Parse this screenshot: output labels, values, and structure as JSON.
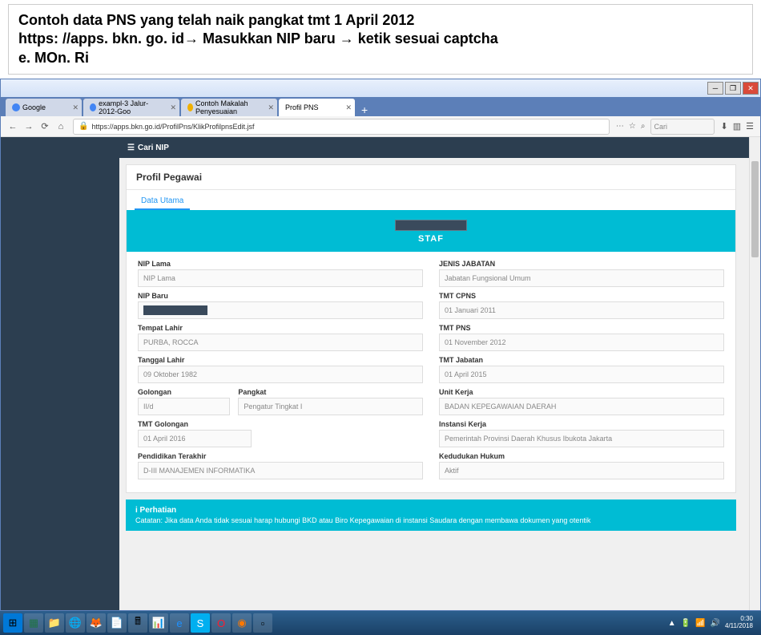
{
  "slide": {
    "line1": "Contoh data PNS yang telah naik pangkat tmt 1 April 2012",
    "line2": "https: //apps. bkn. go. id→ Masukkan NIP baru → ketik sesuai captcha",
    "line3": "e. MOn. Ri"
  },
  "tabs": [
    {
      "label": "Google"
    },
    {
      "label": "exampl-3 Jalur-2012-Goo"
    },
    {
      "label": "Contoh Makalah Penyesuaian"
    },
    {
      "label": "Profil PNS"
    }
  ],
  "browser": {
    "url": "https://apps.bkn.go.id/ProfilPns/KlikProfilpnsEdit.jsf",
    "search_placeholder": "Cari",
    "plus": "+"
  },
  "topbar": {
    "cari_nip": "Cari NIP"
  },
  "profile": {
    "title": "Profil Pegawai",
    "tab": "Data Utama",
    "staff": "STAF"
  },
  "form": {
    "left": {
      "nip_lama_label": "NIP Lama",
      "nip_lama_value": "NIP Lama",
      "nip_baru_label": "NIP Baru",
      "nip_baru_value": "",
      "tempat_lahir_label": "Tempat Lahir",
      "tempat_lahir_value": "PURBA, ROCCA",
      "tanggal_lahir_label": "Tanggal Lahir",
      "tanggal_lahir_value": "09 Oktober 1982",
      "golongan_label": "Golongan",
      "golongan_value": "II/d",
      "pangkat_label": "Pangkat",
      "pangkat_value": "Pengatur Tingkat I",
      "tmt_golongan_label": "TMT Golongan",
      "tmt_golongan_value": "01 April 2016",
      "pendidikan_label": "Pendidikan Terakhir",
      "pendidikan_value": "D-III MANAJEMEN INFORMATIKA"
    },
    "right": {
      "jenis_jabatan_label": "JENIS JABATAN",
      "jenis_jabatan_value": "Jabatan Fungsional Umum",
      "tmt_cpns_label": "TMT CPNS",
      "tmt_cpns_value": "01 Januari 2011",
      "tmt_pns_label": "TMT PNS",
      "tmt_pns_value": "01 November 2012",
      "tmt_jabatan_label": "TMT Jabatan",
      "tmt_jabatan_value": "01 April 2015",
      "unit_kerja_label": "Unit Kerja",
      "unit_kerja_value": "BADAN KEPEGAWAIAN DAERAH",
      "instansi_kerja_label": "Instansi Kerja",
      "instansi_kerja_value": "Pemerintah Provinsi Daerah Khusus Ibukota Jakarta",
      "kedudukan_label": "Kedudukan Hukum",
      "kedudukan_value": "Aktif"
    }
  },
  "perhatian": {
    "title": "i   Perhatian",
    "text": "Catatan: Jika data Anda tidak sesuai harap hubungi BKD atau Biro Kepegawaian di instansi Saudara dengan membawa dokumen yang otentik"
  },
  "taskbar": {
    "time": "0:30",
    "date": "4/11/2018"
  }
}
